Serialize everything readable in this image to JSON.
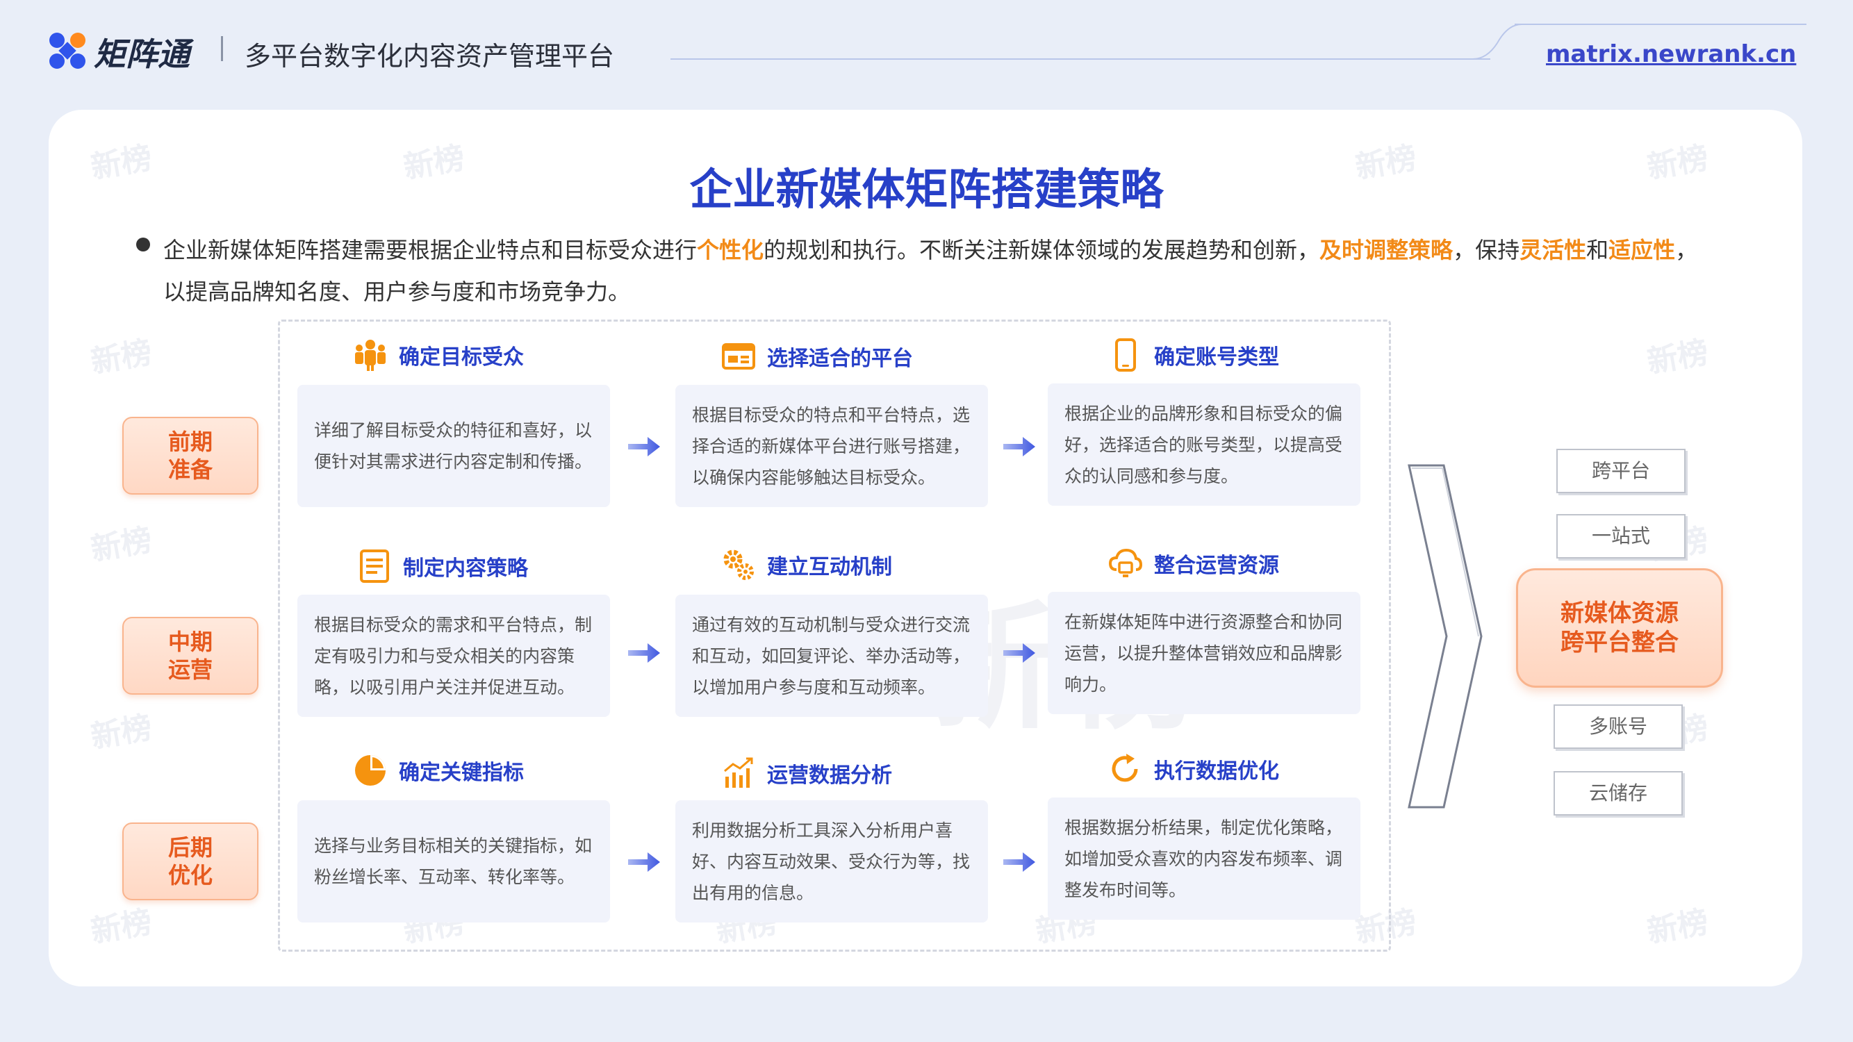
{
  "header": {
    "brand": "矩阵通",
    "subtitle": "多平台数字化内容资产管理平台",
    "url": "matrix.newrank.cn"
  },
  "title": "企业新媒体矩阵搭建策略",
  "intro": {
    "p1": "企业新媒体矩阵搭建需要根据企业特点和目标受众进行",
    "h1": "个性化",
    "p2": "的规划和执行。不断关注新媒体领域的发展趋势和创新，",
    "h2": "及时调整策略",
    "p3": "，保持",
    "h3": "灵活性",
    "p4": "和",
    "h4": "适应性",
    "p5": "，以提高品牌知名度、用户参与度和市场竞争力。"
  },
  "phases": [
    {
      "l1": "前期",
      "l2": "准备"
    },
    {
      "l1": "中期",
      "l2": "运营"
    },
    {
      "l1": "后期",
      "l2": "优化"
    }
  ],
  "steps": [
    {
      "title": "确定目标受众",
      "icon": "people-icon",
      "text": "详细了解目标受众的特征和喜好，以便针对其需求进行内容定制和传播。"
    },
    {
      "title": "选择适合的平台",
      "icon": "browser-window-icon",
      "text": "根据目标受众的特点和平台特点，选择合适的新媒体平台进行账号搭建，以确保内容能够触达目标受众。"
    },
    {
      "title": "确定账号类型",
      "icon": "mobile-phone-icon",
      "text": "根据企业的品牌形象和目标受众的偏好，选择适合的账号类型，以提高受众的认同感和参与度。"
    },
    {
      "title": "制定内容策略",
      "icon": "document-icon",
      "text": "根据目标受众的需求和平台特点，制定有吸引力和与受众相关的内容策略，以吸引用户关注并促进互动。"
    },
    {
      "title": "建立互动机制",
      "icon": "gears-icon",
      "text": "通过有效的互动机制与受众进行交流和互动，如回复评论、举办活动等，以增加用户参与度和互动频率。"
    },
    {
      "title": "整合运营资源",
      "icon": "cloud-monitor-icon",
      "text": "在新媒体矩阵中进行资源整合和协同运营，以提升整体营销效应和品牌影响力。"
    },
    {
      "title": "确定关键指标",
      "icon": "pie-chart-icon",
      "text": "选择与业务目标相关的关键指标，如粉丝增长率、互动率、转化率等。"
    },
    {
      "title": "运营数据分析",
      "icon": "bar-chart-icon",
      "text": "利用数据分析工具深入分析用户喜好、内容互动效果、受众行为等，找出有用的信息。"
    },
    {
      "title": "执行数据优化",
      "icon": "refresh-icon",
      "text": "根据数据分析结果，制定优化策略，如增加受众喜欢的内容发布频率、调整发布时间等。"
    }
  ],
  "right": {
    "tags": [
      "跨平台",
      "一站式",
      "多账号",
      "云储存"
    ],
    "center_l1": "新媒体资源",
    "center_l2": "跨平台整合"
  },
  "watermark": "新榜",
  "colors": {
    "title_blue": "#2740c8",
    "highlight_orange": "#f28a17",
    "phase_orange": "#e65a1e",
    "icon_orange": "#f5930f"
  }
}
